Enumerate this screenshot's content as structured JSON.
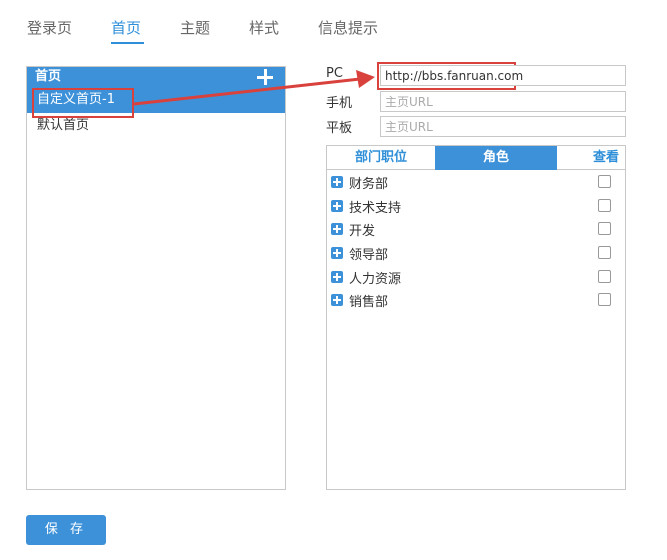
{
  "tabs": [
    {
      "label": "登录页"
    },
    {
      "label": "首页"
    },
    {
      "label": "主题"
    },
    {
      "label": "样式"
    },
    {
      "label": "信息提示"
    }
  ],
  "active_tab": "首页",
  "left_panel": {
    "header": "首页",
    "items": [
      {
        "label": "自定义首页-1",
        "selected": true
      },
      {
        "label": "默认首页",
        "selected": false
      }
    ]
  },
  "form": {
    "pc_label": "PC",
    "pc_value": "http://bbs.fanruan.com",
    "mobile_label": "手机",
    "mobile_placeholder": "主页URL",
    "tablet_label": "平板",
    "tablet_placeholder": "主页URL"
  },
  "right_panel": {
    "tabs": [
      {
        "label": "部门职位"
      },
      {
        "label": "角色"
      },
      {
        "label": "查看"
      }
    ],
    "active_tab": "角色",
    "departments": [
      {
        "name": "财务部",
        "checked": false
      },
      {
        "name": "技术支持",
        "checked": false
      },
      {
        "name": "开发",
        "checked": false
      },
      {
        "name": "领导部",
        "checked": false
      },
      {
        "name": "人力资源",
        "checked": false
      },
      {
        "name": "销售部",
        "checked": false
      }
    ]
  },
  "save_button": "保 存",
  "colors": {
    "accent": "#3d91d9",
    "link": "#2f8fd8",
    "highlight": "#d9413c"
  }
}
